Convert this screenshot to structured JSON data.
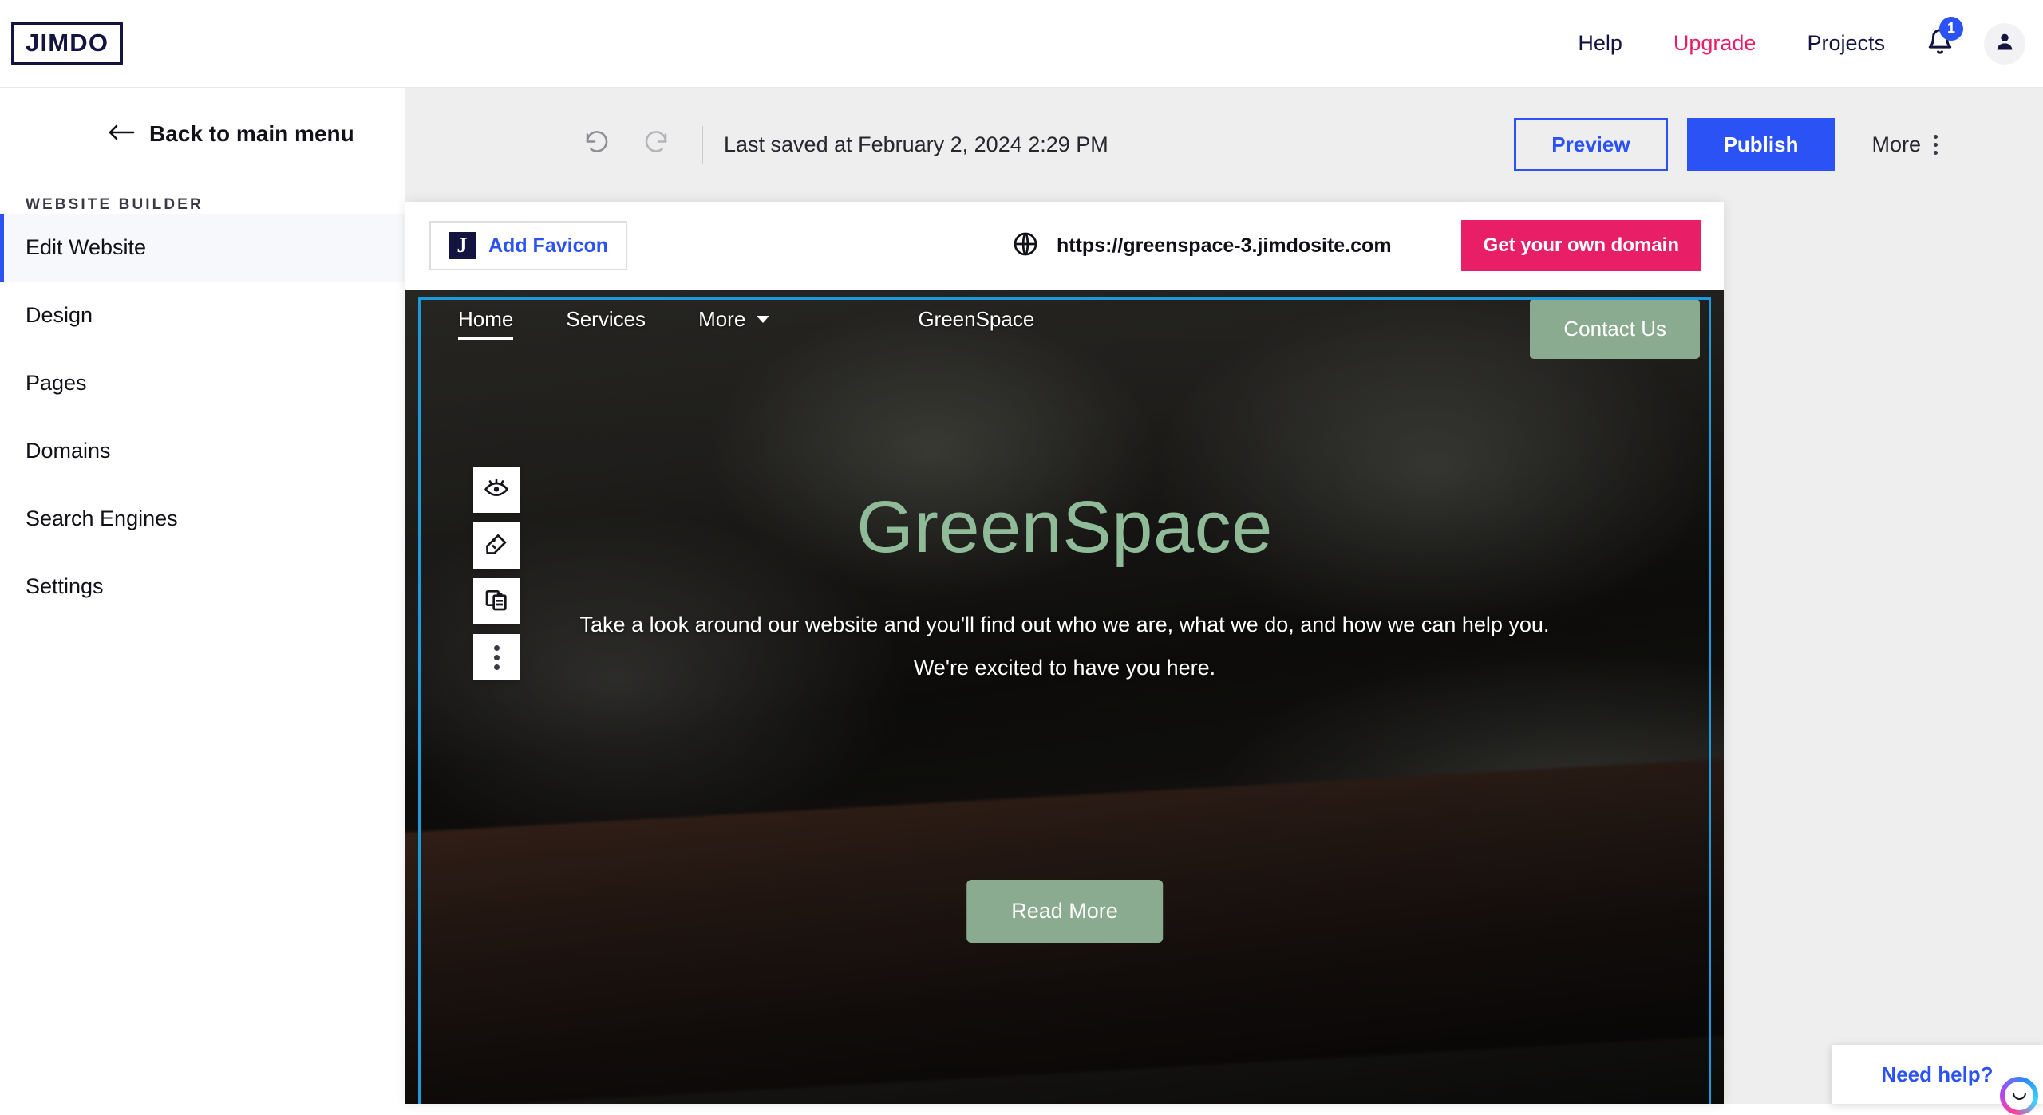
{
  "brand": {
    "logo_text": "JIMDO"
  },
  "topnav": {
    "links": [
      {
        "label": "Help",
        "accent": false
      },
      {
        "label": "Upgrade",
        "accent": true
      },
      {
        "label": "Projects",
        "accent": false
      }
    ],
    "notification_count": "1",
    "bell_icon": "bell-icon",
    "avatar_icon": "user-avatar-icon"
  },
  "sidebar": {
    "back_label": "Back to main menu",
    "back_icon": "arrow-left-icon",
    "section_label": "WEBSITE BUILDER",
    "items": [
      {
        "label": "Edit Website",
        "active": true
      },
      {
        "label": "Design",
        "active": false
      },
      {
        "label": "Pages",
        "active": false
      },
      {
        "label": "Domains",
        "active": false
      },
      {
        "label": "Search Engines",
        "active": false
      },
      {
        "label": "Settings",
        "active": false
      }
    ]
  },
  "toolbar": {
    "undo_icon": "undo-arrow-icon",
    "redo_icon": "redo-arrow-icon",
    "saved_text": "Last saved at February 2, 2024 2:29 PM",
    "preview_label": "Preview",
    "publish_label": "Publish",
    "more_label": "More",
    "more_icon": "kebab-menu-icon"
  },
  "domain_bar": {
    "favicon_letter": "J",
    "favicon_label": "Add Favicon",
    "globe_icon": "globe-icon",
    "url": "https://greenspace-3.jimdosite.com",
    "get_domain_label": "Get your own domain"
  },
  "site_preview": {
    "nav": [
      {
        "label": "Home",
        "current": true
      },
      {
        "label": "Services",
        "current": false
      }
    ],
    "more_label": "More",
    "more_caret_icon": "chevron-down-icon",
    "brand": "GreenSpace",
    "contact_label": "Contact Us",
    "hero_title": "GreenSpace",
    "hero_sub_line1": "Take a look around our website and you'll find out who we are, what we do, and how we can help you.",
    "hero_sub_line2": "We're excited to have you here.",
    "readmore_label": "Read More"
  },
  "element_toolbar": {
    "buttons": [
      {
        "icon": "eye-visibility-icon"
      },
      {
        "icon": "style-palette-tag-icon"
      },
      {
        "icon": "duplicate-copy-icon"
      },
      {
        "icon": "kebab-more-icon"
      }
    ]
  },
  "help_widget": {
    "label": "Need help?",
    "avatar_icon": "chat-smile-avatar-icon"
  },
  "colors": {
    "brand_navy": "#141440",
    "accent_pink": "#e81f67",
    "accent_blue": "#2b52f5",
    "selection_blue": "#1c9ade",
    "site_green": "#8aab8f",
    "hero_title_green": "#8fbb99",
    "sidebar_active_bg": "#f7f8fb",
    "canvas_bg": "#eeeeee"
  }
}
